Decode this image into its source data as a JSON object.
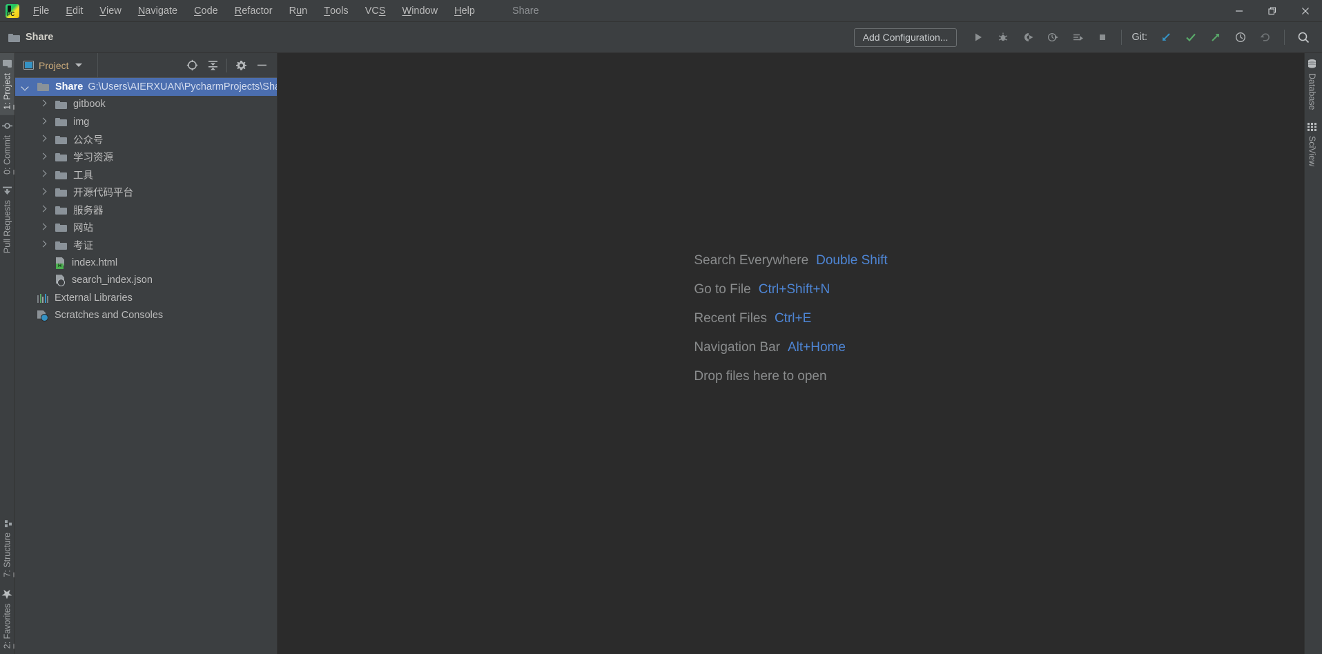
{
  "window": {
    "title_project": "Share",
    "minimize_icon": "minimize-icon",
    "maximize_icon": "restore-icon",
    "close_icon": "close-icon"
  },
  "menubar": {
    "logo": "pycharm-logo-icon",
    "items": [
      {
        "label": "File",
        "mnemonic": "F"
      },
      {
        "label": "Edit",
        "mnemonic": "E"
      },
      {
        "label": "View",
        "mnemonic": "V"
      },
      {
        "label": "Navigate",
        "mnemonic": "N"
      },
      {
        "label": "Code",
        "mnemonic": "C"
      },
      {
        "label": "Refactor",
        "mnemonic": "R"
      },
      {
        "label": "Run",
        "mnemonic": "u"
      },
      {
        "label": "Tools",
        "mnemonic": "T"
      },
      {
        "label": "VCS",
        "mnemonic": "S"
      },
      {
        "label": "Window",
        "mnemonic": "W"
      },
      {
        "label": "Help",
        "mnemonic": "H"
      }
    ]
  },
  "toolbar": {
    "breadcrumb": "Share",
    "breadcrumb_icon": "folder-icon",
    "add_configuration": "Add Configuration...",
    "run_icon": "run-icon",
    "debug_icon": "debug-icon",
    "run_coverage_icon": "run-with-coverage-icon",
    "profile_icon": "profile-icon",
    "run_tests_icon": "run-tests-icon",
    "stop_icon": "stop-icon",
    "git_label": "Git:",
    "git_update_icon": "update-project-icon",
    "git_commit_icon": "commit-icon",
    "git_push_icon": "push-icon",
    "git_history_icon": "history-icon",
    "git_rollback_icon": "rollback-icon",
    "search_icon": "search-icon"
  },
  "left_stripe": {
    "top": [
      {
        "label": "1: Project",
        "mnemonic": "1",
        "icon": "project-folder-icon",
        "active": true
      },
      {
        "label": "0: Commit",
        "mnemonic": "0",
        "icon": "commit-icon",
        "active": false
      },
      {
        "label": "Pull Requests",
        "mnemonic": "",
        "icon": "pull-request-icon",
        "active": false
      }
    ],
    "bottom": [
      {
        "label": "7: Structure",
        "mnemonic": "7",
        "icon": "structure-icon",
        "active": false
      },
      {
        "label": "2: Favorites",
        "mnemonic": "2",
        "icon": "star-icon",
        "active": false
      }
    ]
  },
  "right_stripe": {
    "items": [
      {
        "label": "Database",
        "icon": "database-icon"
      },
      {
        "label": "SciView",
        "icon": "sciview-grid-icon"
      }
    ]
  },
  "project_panel": {
    "title": "Project",
    "title_icon": "project-view-icon",
    "dropdown_icon": "chevron-down-icon",
    "actions": [
      {
        "name": "scroll-from-source-icon"
      },
      {
        "name": "collapse-all-icon"
      },
      {
        "name": "gear-icon"
      },
      {
        "name": "hide-icon"
      }
    ],
    "tree": [
      {
        "label": "Share",
        "path": "G:\\Users\\AIERXUAN\\PycharmProjects\\Share",
        "type": "project-root",
        "expanded": true,
        "selected": true,
        "indent": 0
      },
      {
        "label": "gitbook",
        "type": "folder",
        "expanded": false,
        "selected": false,
        "indent": 1
      },
      {
        "label": "img",
        "type": "folder",
        "expanded": false,
        "selected": false,
        "indent": 1
      },
      {
        "label": "公众号",
        "type": "folder",
        "expanded": false,
        "selected": false,
        "indent": 1
      },
      {
        "label": "学习资源",
        "type": "folder",
        "expanded": false,
        "selected": false,
        "indent": 1
      },
      {
        "label": "工具",
        "type": "folder",
        "expanded": false,
        "selected": false,
        "indent": 1
      },
      {
        "label": "开源代码平台",
        "type": "folder",
        "expanded": false,
        "selected": false,
        "indent": 1
      },
      {
        "label": "服务器",
        "type": "folder",
        "expanded": false,
        "selected": false,
        "indent": 1
      },
      {
        "label": "网站",
        "type": "folder",
        "expanded": false,
        "selected": false,
        "indent": 1
      },
      {
        "label": "考证",
        "type": "folder",
        "expanded": false,
        "selected": false,
        "indent": 1
      },
      {
        "label": "index.html",
        "type": "html-file",
        "selected": false,
        "indent": 1
      },
      {
        "label": "search_index.json",
        "type": "json-file",
        "selected": false,
        "indent": 1
      },
      {
        "label": "External Libraries",
        "type": "libraries",
        "selected": false,
        "indent": 0
      },
      {
        "label": "Scratches and Consoles",
        "type": "scratches",
        "selected": false,
        "indent": 0
      }
    ]
  },
  "editor": {
    "hints": [
      {
        "action": "Search Everywhere",
        "shortcut": "Double Shift"
      },
      {
        "action": "Go to File",
        "shortcut": "Ctrl+Shift+N"
      },
      {
        "action": "Recent Files",
        "shortcut": "Ctrl+E"
      },
      {
        "action": "Navigation Bar",
        "shortcut": "Alt+Home"
      },
      {
        "action": "Drop files here to open",
        "shortcut": ""
      }
    ]
  },
  "colors": {
    "panel_bg": "#3c3f41",
    "editor_bg": "#2b2b2b",
    "selection_blue": "#4b6eaf",
    "hint_key_blue": "#4e86d6",
    "accent_green": "#4caf50"
  }
}
